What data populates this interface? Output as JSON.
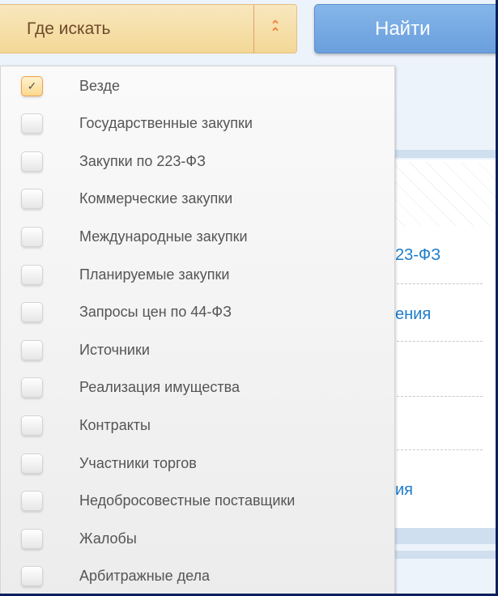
{
  "search_bar": {
    "where_label": "Где искать",
    "toggle_icon": "double-chevron-up-icon",
    "find_label": "Найти"
  },
  "background": {
    "links": [
      "23-ФЗ",
      "ения",
      "ия"
    ]
  },
  "dropdown": {
    "items": [
      {
        "label": "Везде",
        "checked": true
      },
      {
        "label": "Государственные закупки",
        "checked": false
      },
      {
        "label": "Закупки по 223-ФЗ",
        "checked": false
      },
      {
        "label": "Коммерческие закупки",
        "checked": false
      },
      {
        "label": "Международные закупки",
        "checked": false
      },
      {
        "label": "Планируемые закупки",
        "checked": false
      },
      {
        "label": "Запросы цен по 44-ФЗ",
        "checked": false
      },
      {
        "label": "Источники",
        "checked": false
      },
      {
        "label": "Реализация имущества",
        "checked": false
      },
      {
        "label": "Контракты",
        "checked": false
      },
      {
        "label": "Участники торгов",
        "checked": false
      },
      {
        "label": "Недобросовестные поставщики",
        "checked": false
      },
      {
        "label": "Жалобы",
        "checked": false
      },
      {
        "label": "Арбитражные дела",
        "checked": false
      }
    ]
  },
  "colors": {
    "accent": "#f08040",
    "button": "#6a9fdc",
    "link": "#1c7ccc",
    "frame": "#0b1f5e"
  }
}
